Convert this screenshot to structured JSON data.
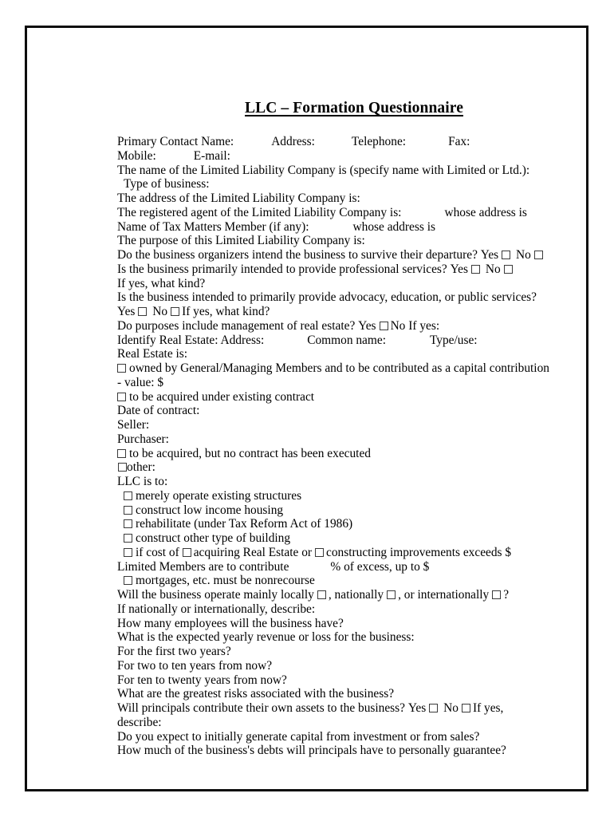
{
  "document": {
    "title": "LLC – Formation Questionnaire",
    "frame_color": "#0d0d0d",
    "text_color": "#000000",
    "background_color": "#ffffff"
  },
  "contact": {
    "primary_contact_label": "Primary Contact Name:",
    "address_label": "Address:",
    "telephone_label": "Telephone:",
    "fax_label": "Fax:",
    "mobile_label": "Mobile:",
    "email_label": "E-mail:"
  },
  "lines": {
    "company_name": "The name of the Limited Liability Company is (specify name with Limited or Ltd.):",
    "type_of_business": "Type of business:",
    "company_address": "The address of the Limited Liability Company is:",
    "registered_agent": "The registered agent of the Limited Liability Company is:",
    "registered_agent_address": "whose address is",
    "tax_matters_member": "Name of Tax Matters Member (if any):",
    "tax_matters_address": "whose address is",
    "purpose": "The purpose of this Limited Liability Company is:",
    "survive_departure": "Do the business organizers intend the business to survive their departure?",
    "professional_services": "Is the business primarily intended to provide professional services?",
    "if_yes_what_kind": "If yes, what kind?",
    "advocacy_services": "Is the business intended to primarily provide advocacy, education, or public services?",
    "advocacy_if_yes": "If yes, what kind?",
    "real_estate_management": "Do purposes include management of real estate?",
    "real_estate_if_yes": "No If yes:",
    "identify_real_estate": "Identify Real Estate: Address:",
    "common_name": "Common name:",
    "type_use": "Type/use:",
    "real_estate_is": "Real Estate is:",
    "owned_by_members": "owned by General/Managing Members and to be contributed as a capital contribution",
    "value": "- value: $",
    "acquired_existing_contract": "to be acquired under existing contract",
    "date_of_contract": "Date of contract:",
    "seller": "Seller:",
    "purchaser": "Purchaser:",
    "acquired_no_contract": "to be acquired, but no contract has been executed",
    "other": "other:",
    "llc_is_to": "LLC is to:",
    "merely_operate": "merely operate existing structures",
    "low_income_housing": "construct low income housing",
    "rehabilitate": "rehabilitate (under Tax Reform Act of 1986)",
    "construct_other": "construct other type of building",
    "if_cost_of": "if cost of",
    "acquiring_real_estate": "acquiring Real Estate or",
    "constructing_improvements": "constructing improvements exceeds $",
    "limited_members_contribute": "Limited Members are to contribute",
    "percent_of_excess": "% of excess, up to $",
    "mortgages_nonrecourse": "mortgages, etc. must be nonrecourse",
    "operate_mainly_locally": "Will the business operate mainly locally",
    "nationally": ", nationally",
    "or_internationally": ", or internationally",
    "question_mark": "?",
    "if_nationally_describe": "If nationally or internationally, describe:",
    "how_many_employees": "How many employees will the business have?",
    "expected_revenue": "What is the expected yearly revenue or loss for the business:",
    "first_two_years": "For the first two years?",
    "two_to_ten_years": "For two to ten years from now?",
    "ten_to_twenty_years": "For ten to twenty years from now?",
    "greatest_risks": "What are the greatest risks associated with the business?",
    "principals_contribute": "Will principals contribute their own assets to the business?",
    "if_yes_comma": "If yes,",
    "describe": "describe:",
    "initially_generate_capital": "Do you expect to initially generate capital from investment or from sales?",
    "personally_guarantee": "How much of the business's debts will principals have to personally guarantee?"
  },
  "options": {
    "yes": "Yes",
    "no": "No"
  }
}
